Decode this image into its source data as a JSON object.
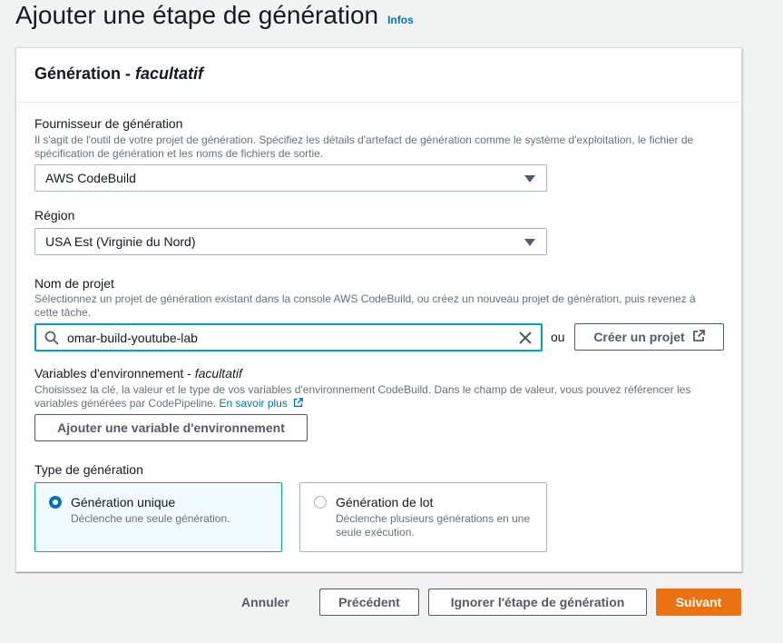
{
  "page": {
    "title": "Ajouter une étape de génération",
    "info_link": "Infos"
  },
  "section": {
    "title": "Génération",
    "separator": " - ",
    "optional": "facultatif"
  },
  "provider": {
    "label": "Fournisseur de génération",
    "description": "Il s'agit de l'outil de votre projet de génération. Spécifiez les détails d'artefact de génération comme le système d'exploitation, le fichier de spécification de génération et les noms de fichiers de sortie.",
    "value": "AWS CodeBuild"
  },
  "region": {
    "label": "Région",
    "value": "USA Est (Virginie du Nord)"
  },
  "project": {
    "label": "Nom de projet",
    "description": "Sélectionnez un projet de génération existant dans la console AWS CodeBuild, ou créez un nouveau projet de génération, puis revenez à cette tâche.",
    "value": "omar-build-youtube-lab",
    "or_text": "ou",
    "create_label": "Créer un projet"
  },
  "env_vars": {
    "label": "Variables d'environnement - ",
    "optional": "facultatif",
    "description": "Choisissez la clé, la valeur et le type de vos variables d'environnement CodeBuild. Dans le champ de valeur, vous pouvez référencer les variables générées par CodePipeline.",
    "learn_more": "En savoir plus",
    "add_label": "Ajouter une variable d'environnement"
  },
  "build_type": {
    "label": "Type de génération",
    "options": [
      {
        "label": "Génération unique",
        "description": "Déclenche une seule génération.",
        "selected": true
      },
      {
        "label": "Génération de lot",
        "description": "Déclenche plusieurs générations en une seule exécution.",
        "selected": false
      }
    ]
  },
  "footer": {
    "cancel": "Annuler",
    "previous": "Précédent",
    "skip": "Ignorer l'étape de génération",
    "next": "Suivant"
  },
  "colors": {
    "accent": "#ec7211",
    "link": "#0073bb",
    "focus": "#00a1c9"
  }
}
